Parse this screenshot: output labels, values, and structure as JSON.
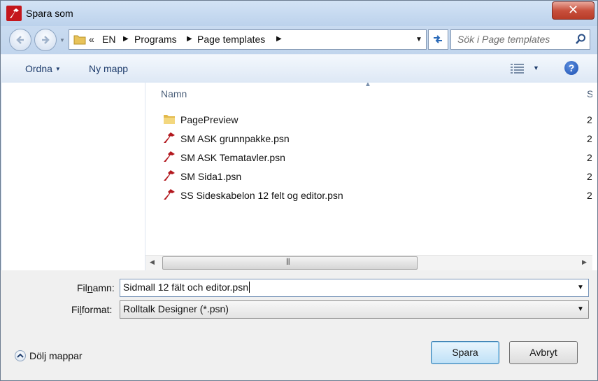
{
  "window": {
    "title": "Spara som",
    "close_label": "✕"
  },
  "navbar": {
    "crumb_prefix": "«",
    "crumbs": [
      "EN",
      "Programs",
      "Page templates"
    ],
    "search_placeholder": "Sök i Page templates"
  },
  "toolbar": {
    "organize_label": "Ordna",
    "new_folder_label": "Ny mapp",
    "help_label": "?"
  },
  "file_list": {
    "column_name": "Namn",
    "column_next": "S",
    "items": [
      {
        "name": "PagePreview",
        "type": "folder",
        "next_col": "2"
      },
      {
        "name": "SM ASK grunnpakke.psn",
        "type": "psn",
        "next_col": "2"
      },
      {
        "name": "SM ASK Tematavler.psn",
        "type": "psn",
        "next_col": "2"
      },
      {
        "name": "SM Sida1.psn",
        "type": "psn",
        "next_col": "2"
      },
      {
        "name": "SS Sideskabelon 12 felt og editor.psn",
        "type": "psn",
        "next_col": "2"
      }
    ]
  },
  "form": {
    "filename_label_pre": "Fil",
    "filename_label_u": "n",
    "filename_label_post": "amn:",
    "filename_value": "Sidmall 12 fält och editor.psn",
    "format_label_pre": "Fi",
    "format_label_u": "l",
    "format_label_post": "format:",
    "format_value": "Rolltalk Designer (*.psn)"
  },
  "footer": {
    "hide_folders_label": "Dölj mappar",
    "save_label": "Spara",
    "cancel_label": "Avbryt"
  },
  "colors": {
    "title_bar": "#c3d6ee",
    "close_button": "#c8503d",
    "app_icon": "#c4161c",
    "primary_button": "#bfe1f7"
  }
}
